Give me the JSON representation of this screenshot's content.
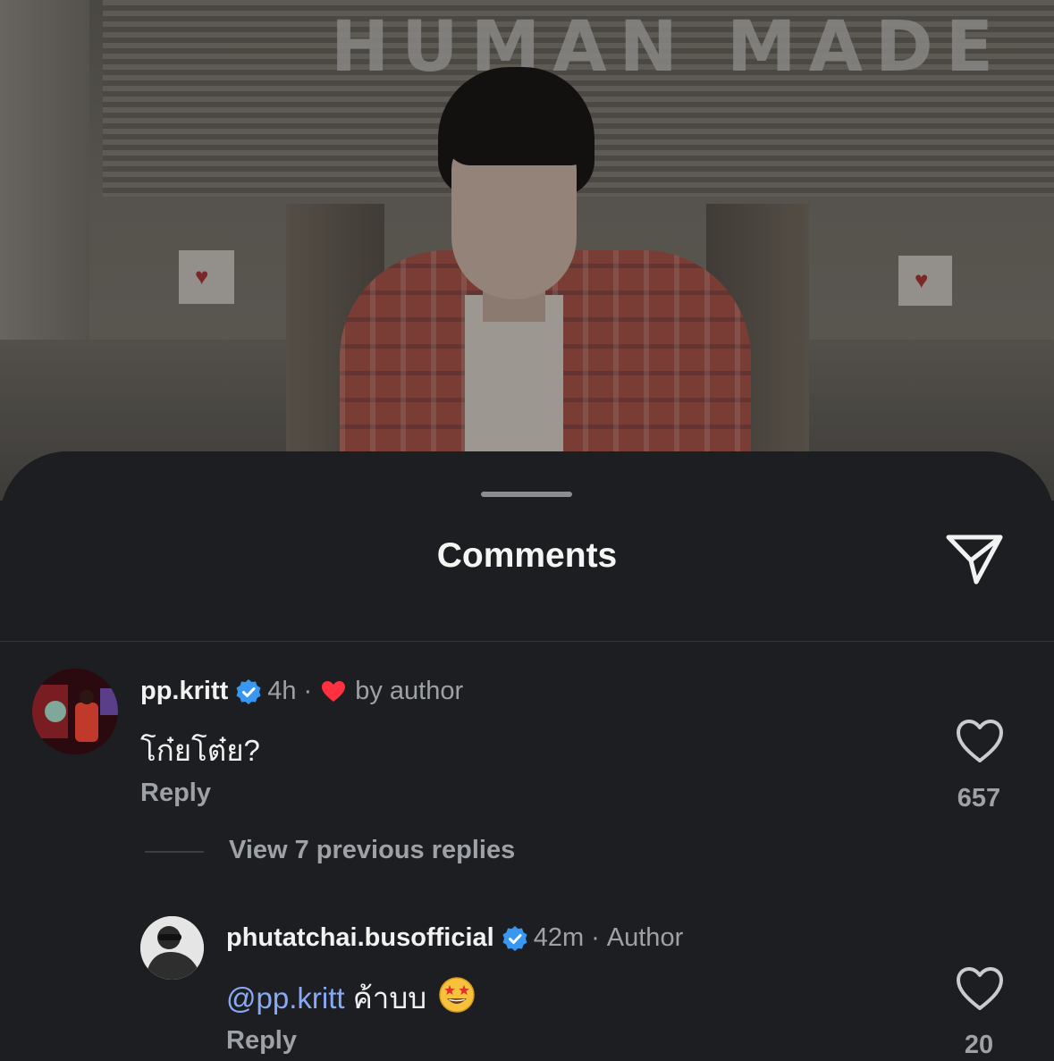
{
  "photo": {
    "store_sign": "HUMAN MADE"
  },
  "sheet": {
    "title": "Comments",
    "share_icon": "paper-plane-icon"
  },
  "comments": [
    {
      "username": "pp.kritt",
      "verified": true,
      "time": "4h",
      "separator": "·",
      "liked_by_author_label": "by author",
      "text": "โก๋ยโต๋ย?",
      "reply_label": "Reply",
      "like_count": "657"
    }
  ],
  "view_replies_label": "View 7 previous replies",
  "replies": [
    {
      "username": "phutatchai.busofficial",
      "verified": true,
      "time": "42m",
      "separator": "·",
      "author_label": "Author",
      "mention": "@pp.kritt",
      "text": "ค้าบบ",
      "emoji": "star-struck-emoji",
      "reply_label": "Reply",
      "like_count": "20"
    }
  ],
  "colors": {
    "sheet_background": "#1c1e21",
    "mention": "#8aa9f5",
    "verified_badge": "#3897f0",
    "liked_heart": "#ff3040",
    "secondary_text": "#9ea1a6"
  }
}
